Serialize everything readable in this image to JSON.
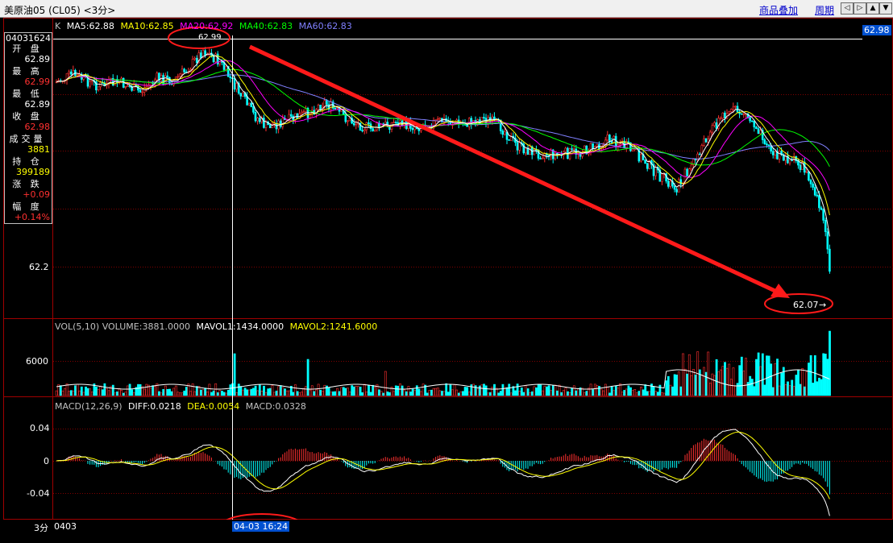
{
  "window": {
    "title": "美原油05 (CL05) <3分>",
    "links": [
      "商品叠加",
      "周期"
    ]
  },
  "nav_buttons": [
    "◁",
    "▷",
    "▲",
    "▼"
  ],
  "price_panel": {
    "legend": {
      "k": "K",
      "ma5": "MA5:62.88",
      "ma10": "MA10:62.85",
      "ma20": "MA20:62.92",
      "ma40": "MA40:62.83",
      "ma60": "MA60:62.83"
    },
    "price_tag": "62.98",
    "high_marker": "62.99",
    "low_marker": "62.07",
    "axis_label": "62.2"
  },
  "info_box": {
    "id": "04031624",
    "rows": [
      {
        "label": "开 盘",
        "value": "62.89",
        "color": "#ffffff"
      },
      {
        "label": "最 高",
        "value": "62.99",
        "color": "#ff3030"
      },
      {
        "label": "最 低",
        "value": "62.89",
        "color": "#ffffff"
      },
      {
        "label": "收 盘",
        "value": "62.98",
        "color": "#ff3030"
      },
      {
        "label": "成交量",
        "value": "3881",
        "color": "#ffff00"
      },
      {
        "label": "持 仓",
        "value": "399189",
        "color": "#ffff00"
      },
      {
        "label": "涨 跌",
        "value": "+0.09",
        "color": "#ff3030"
      },
      {
        "label": "幅 度",
        "value": "+0.14%",
        "color": "#ff3030"
      }
    ]
  },
  "volume_panel": {
    "legend": {
      "title": "VOL(5,10) VOLUME:3881.0000",
      "mavol1": "MAVOL1:1434.0000",
      "mavol2": "MAVOL2:1241.6000"
    },
    "axis_label": "6000"
  },
  "macd_panel": {
    "legend": {
      "title": "MACD(12,26,9)",
      "diff": "DIFF:0.0218",
      "dea": "DEA:0.0054",
      "macd": "MACD:0.0328"
    },
    "axis_labels": [
      "0.04",
      "0",
      "-0.04"
    ]
  },
  "footer": {
    "period": "3分",
    "date": "0403",
    "crosshair_time": "04-03 16:24"
  },
  "colors": {
    "up": "#ff3030",
    "down": "#00ffff",
    "ma5": "#ffffff",
    "ma10": "#ffff00",
    "ma20": "#ff00ff",
    "ma40": "#00ff00",
    "ma60": "#8080ff",
    "grid": "#800000",
    "annotation": "#ff0000"
  }
}
